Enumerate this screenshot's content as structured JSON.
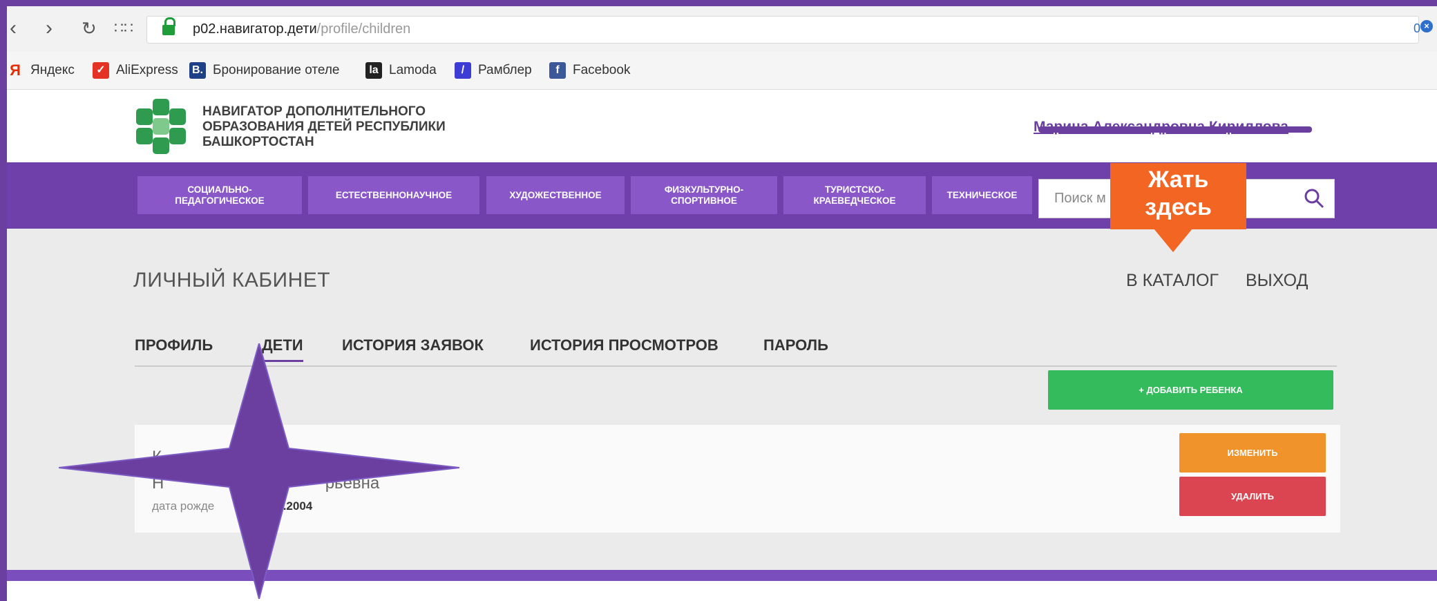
{
  "browser": {
    "url_host": "p02.навигатор.дети",
    "url_path": "/profile/children",
    "ext_count": "0",
    "bookmarks": [
      {
        "label": "Яндекс",
        "icon": "yandex-icon",
        "color": "#e62e04"
      },
      {
        "label": "AliExpress",
        "icon": "aliexpress-icon",
        "color": "#e43225"
      },
      {
        "label": "Бронирование отеле",
        "icon": "booking-icon",
        "color": "#1f3f87"
      },
      {
        "label": "Lamoda",
        "icon": "lamoda-icon",
        "color": "#222222"
      },
      {
        "label": "Рамблер",
        "icon": "rambler-icon",
        "color": "#3d3dd6"
      },
      {
        "label": "Facebook",
        "icon": "facebook-icon",
        "color": "#3b5998"
      }
    ]
  },
  "site": {
    "title_lines": [
      "НАВИГАТОР ДОПОЛНИТЕЛЬНОГО",
      "ОБРАЗОВАНИЯ ДЕТЕЙ РЕСПУБЛИКИ",
      "БАШКОРТОСТАН"
    ],
    "user_name": "Марина Александровна Кириллова"
  },
  "categories": [
    "СОЦИАЛЬНО-ПЕДАГОГИЧЕСКОЕ",
    "ЕСТЕСТВЕННОНАУЧНОЕ",
    "ХУДОЖЕСТВЕННОЕ",
    "ФИЗКУЛЬТУРНО-СПОРТИВНОЕ",
    "ТУРИСТСКО-КРАЕВЕДЧЕСКОЕ",
    "ТЕХНИЧЕСКОЕ"
  ],
  "search": {
    "placeholder": "Поиск м"
  },
  "main": {
    "title": "ЛИЧНЫЙ КАБИНЕТ",
    "catalog_link": "В КАТАЛОГ",
    "logout_link": "ВЫХОД",
    "tabs": [
      "ПРОФИЛЬ",
      "ДЕТИ",
      "ИСТОРИЯ ЗАЯВОК",
      "ИСТОРИЯ ПРОСМОТРОВ",
      "ПАРОЛЬ"
    ],
    "active_tab": "ДЕТИ",
    "add_child_label": "+ ДОБАВИТЬ РЕБЕНКА"
  },
  "child": {
    "name_line1": "К",
    "name_line2": "Н                                   рьевна",
    "birth_label": "дата рожде",
    "birth_value": "1.2004",
    "edit_label": "ИЗМЕНИТЬ",
    "delete_label": "УДАЛИТЬ"
  },
  "annotation": {
    "callout_line1": "Жать",
    "callout_line2": "здесь",
    "callout_color": "#f26522",
    "star_color": "#6b3fa0"
  }
}
